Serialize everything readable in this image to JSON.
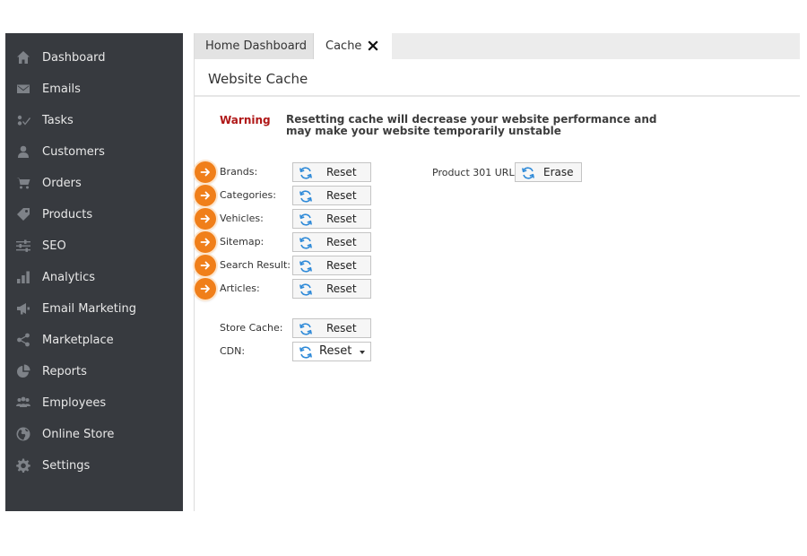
{
  "sidebar": {
    "items": [
      {
        "label": "Dashboard",
        "icon": "home-icon"
      },
      {
        "label": "Emails",
        "icon": "envelope-icon"
      },
      {
        "label": "Tasks",
        "icon": "tasks-icon"
      },
      {
        "label": "Customers",
        "icon": "user-icon"
      },
      {
        "label": "Orders",
        "icon": "cart-icon"
      },
      {
        "label": "Products",
        "icon": "tag-icon"
      },
      {
        "label": "SEO",
        "icon": "sliders-icon"
      },
      {
        "label": "Analytics",
        "icon": "bar-chart-icon"
      },
      {
        "label": "Email Marketing",
        "icon": "megaphone-icon"
      },
      {
        "label": "Marketplace",
        "icon": "share-icon"
      },
      {
        "label": "Reports",
        "icon": "pie-chart-icon"
      },
      {
        "label": "Employees",
        "icon": "group-icon"
      },
      {
        "label": "Online Store",
        "icon": "globe-icon"
      },
      {
        "label": "Settings",
        "icon": "gear-icon"
      }
    ]
  },
  "tabs": {
    "home": "Home Dashboard",
    "cache": "Cache"
  },
  "page": {
    "title": "Website Cache",
    "warning_label": "Warning",
    "warning_text": "Resetting cache will decrease your website performance and may make your website temporarily unstable"
  },
  "cache_rows": [
    {
      "label": "Brands:",
      "button": "Reset"
    },
    {
      "label": "Categories:",
      "button": "Reset"
    },
    {
      "label": "Vehicles:",
      "button": "Reset"
    },
    {
      "label": "Sitemap:",
      "button": "Reset"
    },
    {
      "label": "Search Result:",
      "button": "Reset"
    },
    {
      "label": "Articles:",
      "button": "Reset"
    }
  ],
  "product301": {
    "label": "Product 301 URL",
    "button": "Erase"
  },
  "store_cache": {
    "label": "Store Cache:",
    "button": "Reset"
  },
  "cdn": {
    "label": "CDN:",
    "button": "Reset"
  },
  "colors": {
    "sidebar_bg": "#373a3f",
    "accent_orange": "#f07f1a",
    "warning_red": "#b01818",
    "refresh_blue": "#2f8ad8"
  }
}
